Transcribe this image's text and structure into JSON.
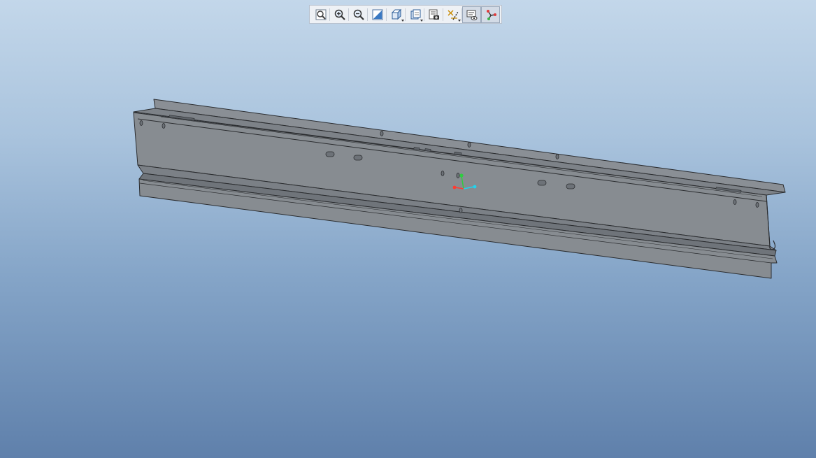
{
  "toolbar": {
    "buttons": [
      {
        "name": "refit-icon"
      },
      {
        "name": "zoom-in-icon"
      },
      {
        "name": "zoom-out-icon"
      },
      {
        "name": "repaint-icon"
      },
      {
        "name": "display-style-icon"
      },
      {
        "name": "saved-views-icon"
      },
      {
        "name": "view-manager-icon"
      },
      {
        "name": "datum-display-icon"
      },
      {
        "name": "annotation-display-icon"
      },
      {
        "name": "spin-center-icon"
      }
    ]
  },
  "model": {
    "part_color": "#878c91",
    "edge_color": "#2a2c2f"
  },
  "csys": {
    "x_color": "#ff3b30",
    "y_color": "#2ecc40",
    "z_color": "#22d3ee"
  }
}
